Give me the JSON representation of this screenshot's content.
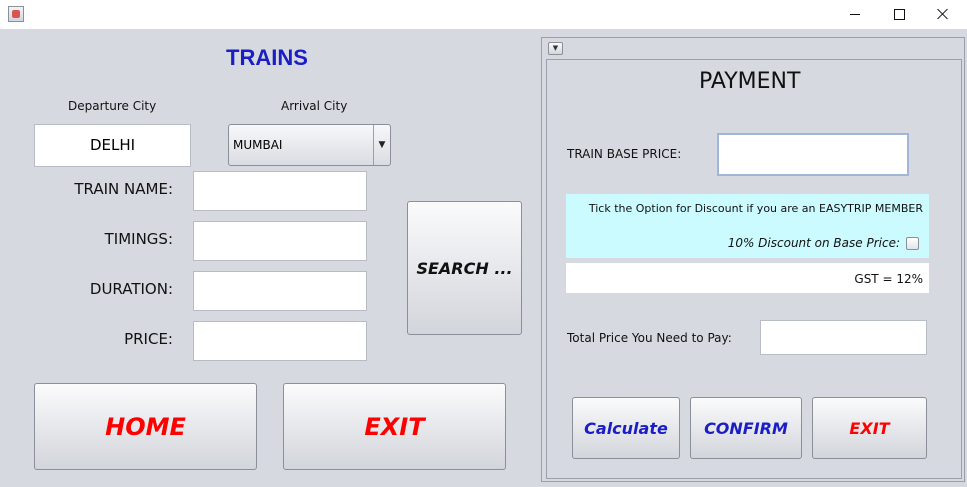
{
  "window": {
    "controls": {
      "minimize_icon": "minimize-icon",
      "maximize_icon": "maximize-icon",
      "close_icon": "close-icon"
    }
  },
  "trains": {
    "title": "TRAINS",
    "departure_label": "Departure City",
    "arrival_label": "Arrival City",
    "departure_value": "DELHI",
    "arrival_value": "MUMBAI",
    "fields": {
      "train_name_label": "TRAIN NAME:",
      "timings_label": "TIMINGS:",
      "duration_label": "DURATION:",
      "price_label": "PRICE:"
    },
    "search_button": "SEARCH ...",
    "home_button": "HOME",
    "exit_button": "EXIT"
  },
  "payment": {
    "title": "PAYMENT",
    "base_price_label": "TRAIN BASE PRICE:",
    "discount_note": "Tick the Option for Discount if you are an EASYTRIP MEMBER",
    "discount_label": "10% Discount on Base Price:",
    "gst_text": "GST = 12%",
    "total_label": "Total Price You Need to Pay:",
    "calculate_button": "Calculate",
    "confirm_button": "CONFIRM",
    "exit_button": "EXIT"
  },
  "colors": {
    "blue": "#1a1ec4",
    "red": "#ff0000",
    "cyan_panel": "#ccfbff",
    "background": "#d6d9df"
  }
}
